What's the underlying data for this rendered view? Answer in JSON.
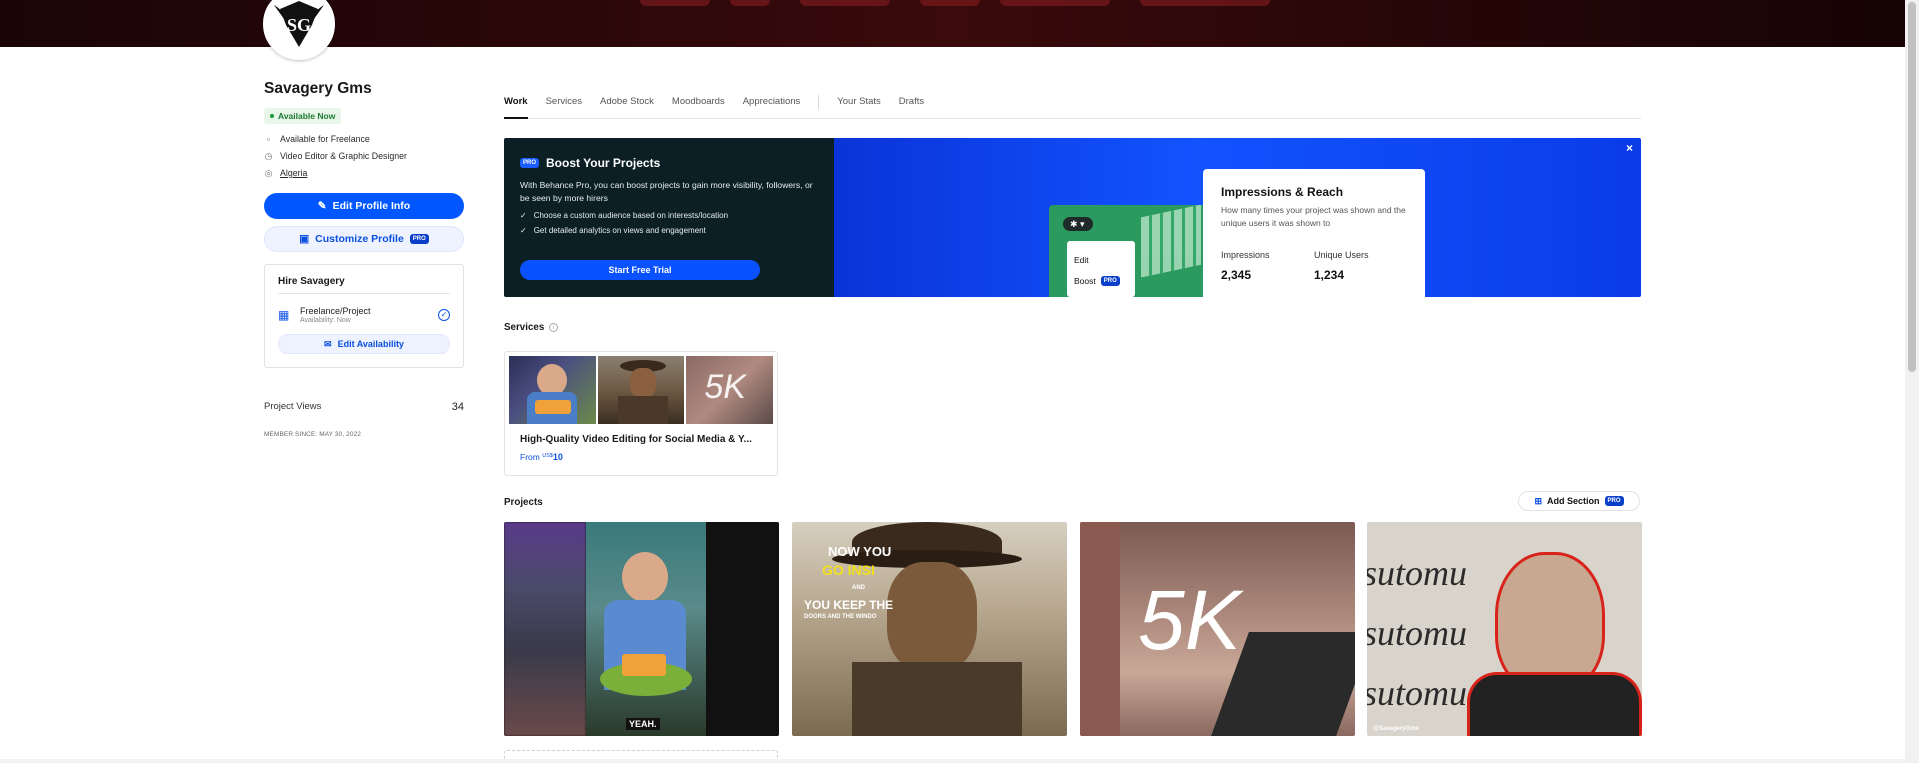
{
  "profile": {
    "name": "Savagery Gms",
    "status": "Available Now",
    "info": [
      "Available for Freelance",
      "Video Editor & Graphic Designer"
    ],
    "location": "Algeria",
    "edit_profile_label": "Edit Profile Info",
    "customize_label": "Customize Profile",
    "pro_label": "PRO"
  },
  "hire": {
    "title": "Hire Savagery",
    "item_title": "Freelance/Project",
    "item_sub": "Availability: Now",
    "edit_availability_label": "Edit Availability"
  },
  "stats": {
    "views_label": "Project Views",
    "views_value": "34",
    "member_since": "MEMBER SINCE: MAY 30, 2022"
  },
  "tabs": [
    "Work",
    "Services",
    "Adobe Stock",
    "Moodboards",
    "Appreciations",
    "Your Stats",
    "Drafts"
  ],
  "promo": {
    "badge": "PRO",
    "title": "Boost Your Projects",
    "description": "With Behance Pro, you can boost projects to gain more visibility, followers, or be seen by more hirers",
    "checks": [
      "Choose a custom audience based on interests/location",
      "Get detailed analytics on views and engagement"
    ],
    "cta": "Start Free Trial",
    "close": "×",
    "menu_edit": "Edit",
    "menu_boost": "Boost",
    "card_title": "Impressions & Reach",
    "card_desc": "How many times your project was shown and the unique users it was shown to",
    "impressions_label": "Impressions",
    "impressions_value": "2,345",
    "unique_label": "Unique Users",
    "unique_value": "1,234"
  },
  "services": {
    "heading": "Services",
    "card_title": "High-Quality Video Editing for Social Media & Y...",
    "price_from": "From",
    "price_currency": "US$",
    "price_value": "10",
    "thumb_text": "5K"
  },
  "projects": {
    "heading": "Projects",
    "add_section_label": "Add Section",
    "items": [
      {
        "caption": "YEAH."
      },
      {
        "line1": "NOW YOU",
        "line2": "GO INSI",
        "line3": "AND",
        "line4": "YOU KEEP THE",
        "line5": "DOORS AND THE WINDO"
      },
      {
        "caption": "5K"
      },
      {
        "word": "sutomu",
        "credit": "@SavageryGms"
      }
    ]
  },
  "colors": {
    "accent": "#0057ff",
    "available_green": "#1b7b30"
  }
}
